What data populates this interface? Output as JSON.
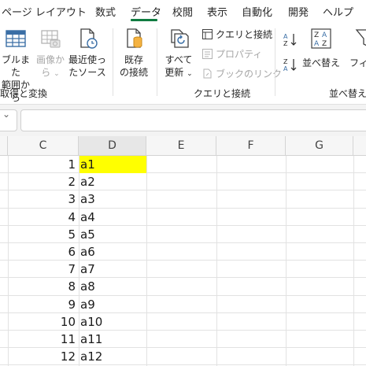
{
  "tabs": [
    {
      "label": "ページ レイアウト"
    },
    {
      "label": "数式"
    },
    {
      "label": "データ"
    },
    {
      "label": "校閲"
    },
    {
      "label": "表示"
    },
    {
      "label": "自動化"
    },
    {
      "label": "開発"
    },
    {
      "label": "ヘルプ"
    }
  ],
  "active_tab": "データ",
  "ribbon": {
    "groups": {
      "get_transform": {
        "label": "取得と変換",
        "from_table": {
          "line1": "ブルまた",
          "line2": "範囲から"
        },
        "from_picture": {
          "line1": "画像か",
          "line2": "ら"
        },
        "recent_sources": {
          "line1": "最近使っ",
          "line2": "たソース"
        },
        "existing_connections": {
          "line1": "既存",
          "line2": "の接続"
        }
      },
      "queries_connections": {
        "label": "クエリと接続",
        "refresh_all": {
          "line1": "すべて",
          "line2": "更新"
        },
        "queries_and_connections": "クエリと接続",
        "properties": "プロパティ",
        "edit_links": "ブックのリンク"
      },
      "sort_filter": {
        "label": "並べ替え",
        "sort_label": "並べ替え",
        "filter_label": "フィル"
      }
    }
  },
  "formula_bar": {
    "value": ""
  },
  "columns": [
    "C",
    "D",
    "E",
    "F",
    "G"
  ],
  "selected_column": "D",
  "rows": [
    {
      "num": "1",
      "text": "a1",
      "highlight": "#ffff00"
    },
    {
      "num": "2",
      "text": "a2"
    },
    {
      "num": "3",
      "text": "a3"
    },
    {
      "num": "4",
      "text": "a4"
    },
    {
      "num": "5",
      "text": "a5"
    },
    {
      "num": "6",
      "text": "a6"
    },
    {
      "num": "7",
      "text": "a7"
    },
    {
      "num": "8",
      "text": "a8"
    },
    {
      "num": "9",
      "text": "a9"
    },
    {
      "num": "10",
      "text": "a10"
    },
    {
      "num": "11",
      "text": "a11"
    },
    {
      "num": "12",
      "text": "a12"
    }
  ],
  "colors": {
    "accent": "#107c41",
    "highlight": "#ffff00"
  },
  "icons": {
    "from_table": "table-icon",
    "from_picture": "picture-table-icon",
    "recent_sources": "clock-document-icon",
    "existing_connections": "database-document-icon",
    "refresh_all": "refresh-icon",
    "queries": "queries-icon",
    "properties": "properties-icon",
    "edit_links": "links-icon",
    "sort_az": "sort-ascending-icon",
    "sort_za": "sort-descending-icon",
    "sort": "sort-dialog-icon",
    "filter": "filter-icon"
  }
}
